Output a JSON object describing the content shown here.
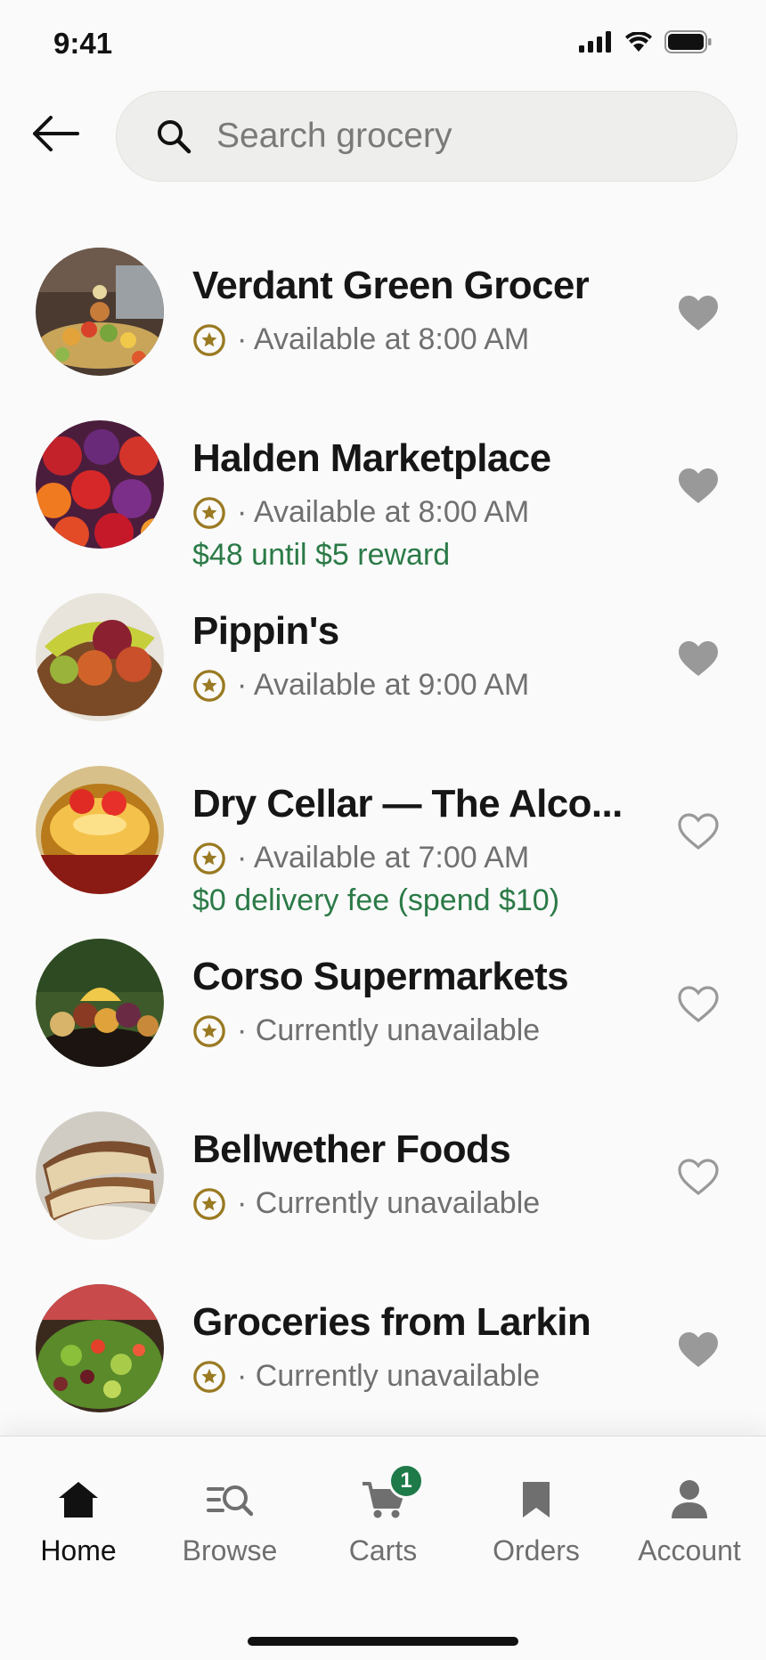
{
  "status_bar": {
    "time": "9:41"
  },
  "search": {
    "placeholder": "Search grocery"
  },
  "stores": [
    {
      "name": "Verdant Green Grocer",
      "availability": "· Available at 8:00 AM",
      "promo": "",
      "favorited": true
    },
    {
      "name": "Halden Marketplace",
      "availability": "· Available at 8:00 AM",
      "promo": "$48 until $5 reward",
      "favorited": true
    },
    {
      "name": "Pippin's",
      "availability": "· Available at 9:00 AM",
      "promo": "",
      "favorited": true
    },
    {
      "name": "Dry Cellar — The Alco...",
      "availability": "· Available at 7:00 AM",
      "promo": "$0 delivery fee (spend $10)",
      "favorited": false
    },
    {
      "name": "Corso Supermarkets",
      "availability": "· Currently unavailable",
      "promo": "",
      "favorited": false
    },
    {
      "name": "Bellwether Foods",
      "availability": "· Currently unavailable",
      "promo": "",
      "favorited": false
    },
    {
      "name": "Groceries from Larkin",
      "availability": "· Currently unavailable",
      "promo": "",
      "favorited": true
    }
  ],
  "nav": {
    "home": "Home",
    "browse": "Browse",
    "carts": "Carts",
    "cart_count": "1",
    "orders": "Orders",
    "account": "Account"
  },
  "colors": {
    "promo": "#2b7a47",
    "star": "#9a7a22",
    "badge": "#1f7a49",
    "fav_filled": "#999999"
  }
}
